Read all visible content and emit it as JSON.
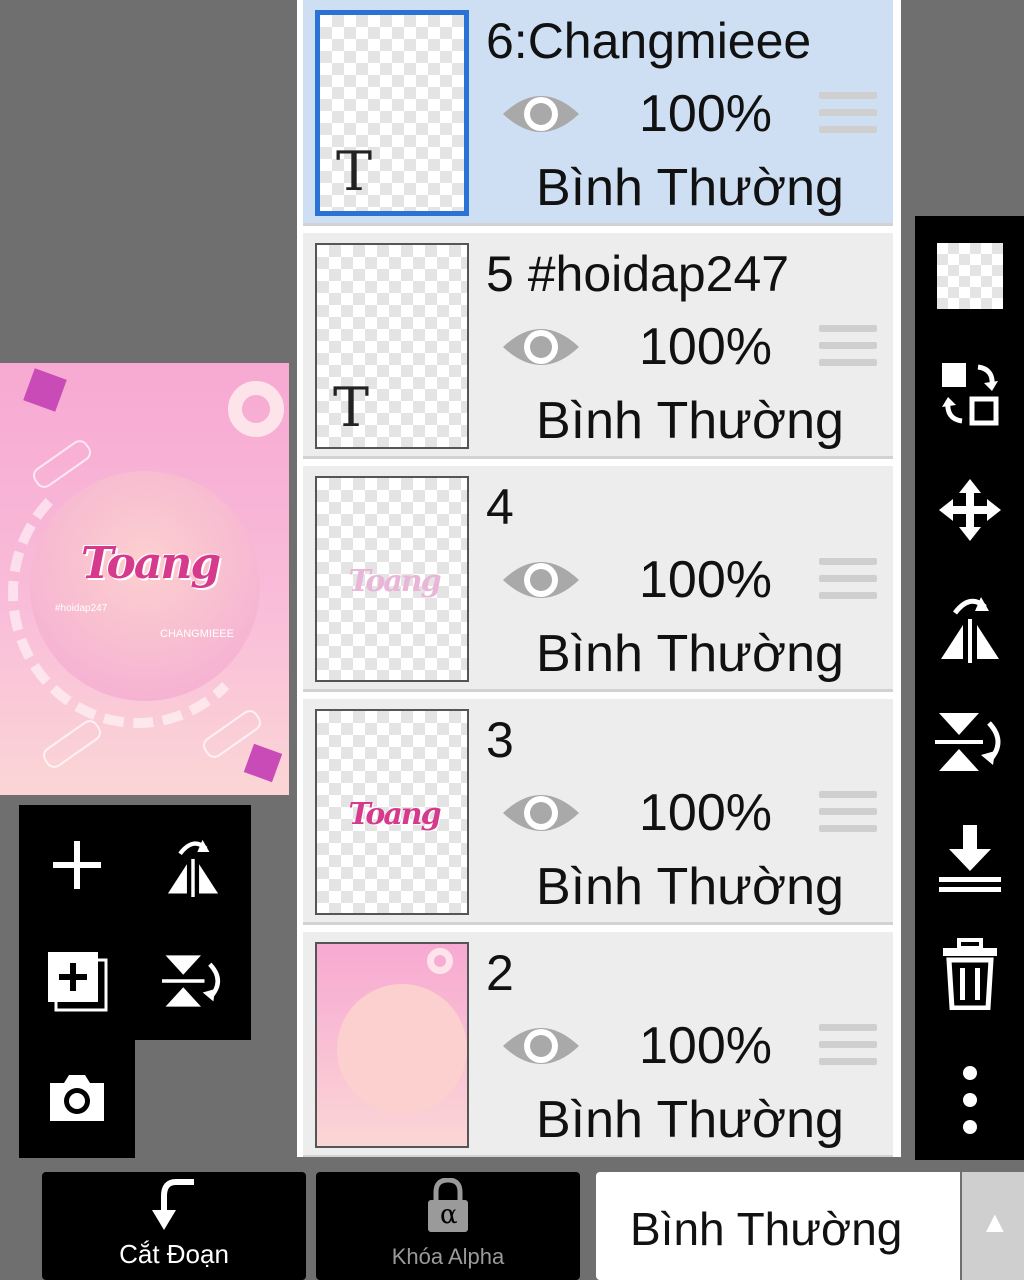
{
  "preview": {
    "title_art": "Toang",
    "small_text_1": "#hoidap247",
    "small_text_2": "CHANGMIEEE"
  },
  "layers": [
    {
      "name": "6:Changmieee",
      "opacity": "100%",
      "blend": "Bình Thường",
      "selected": true,
      "thumb": "text"
    },
    {
      "name": "5 #hoidap247",
      "opacity": "100%",
      "blend": "Bình Thường",
      "selected": false,
      "thumb": "text"
    },
    {
      "name": "4",
      "opacity": "100%",
      "blend": "Bình Thường",
      "selected": false,
      "thumb": "faded-word"
    },
    {
      "name": "3",
      "opacity": "100%",
      "blend": "Bình Thường",
      "selected": false,
      "thumb": "word"
    },
    {
      "name": "2",
      "opacity": "100%",
      "blend": "Bình Thường",
      "selected": false,
      "thumb": "background"
    }
  ],
  "thumb_glyph": "T",
  "thumb_word": "Toang",
  "right_tools": [
    "transparency-icon",
    "swap-layers-icon",
    "move-icon",
    "flip-horizontal-icon",
    "flip-vertical-icon",
    "merge-down-icon",
    "trash-icon",
    "more-icon"
  ],
  "left_tools": [
    "add-layer-icon",
    "flip-horizontal-icon",
    "add-layer-copy-icon",
    "flip-vertical-icon",
    "camera-icon"
  ],
  "bottom_bar": {
    "clip_label": "Cắt Đoạn",
    "alpha_lock_label": "Khóa Alpha",
    "alpha_glyph": "α",
    "blend_mode": "Bình Thường",
    "arrow": "▲"
  },
  "colors": {
    "selected_layer": "#cfdff3",
    "selected_border": "#2a73d4",
    "accent_pink": "#d63a8c"
  }
}
